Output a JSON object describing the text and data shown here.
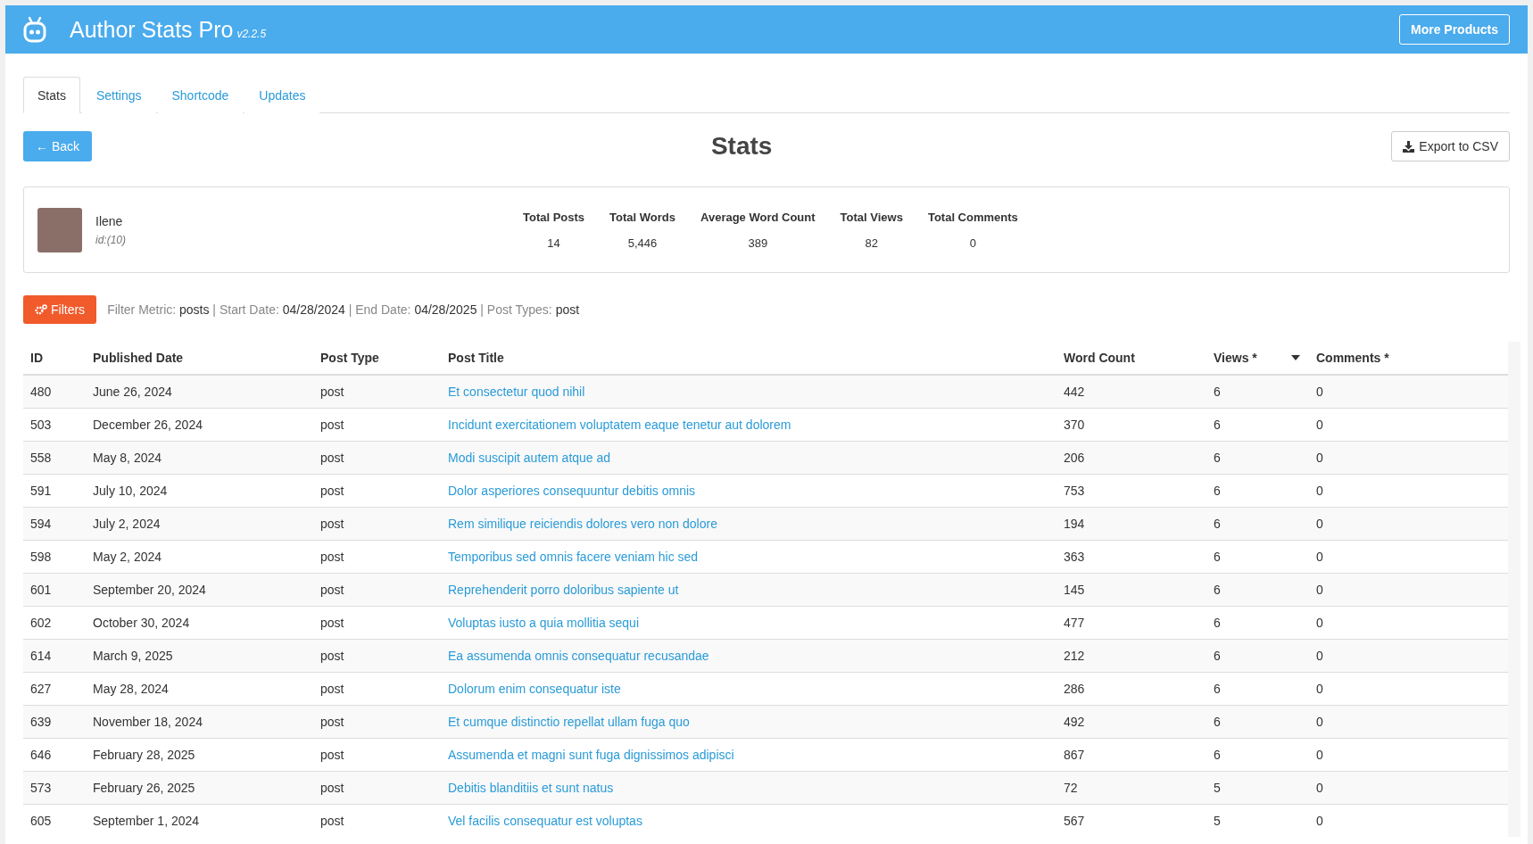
{
  "header": {
    "title": "Author Stats Pro",
    "version": "v2.2.5",
    "button": "More Products"
  },
  "tabs": [
    {
      "label": "Stats",
      "selected": true
    },
    {
      "label": "Settings",
      "selected": false
    },
    {
      "label": "Shortcode",
      "selected": false
    },
    {
      "label": "Updates",
      "selected": false
    }
  ],
  "toolbar": {
    "back": "← Back",
    "title": "Stats",
    "export": "Export to CSV"
  },
  "author": {
    "name": "Ilene",
    "id": "id:(10)"
  },
  "totals": [
    {
      "label": "Total Posts",
      "value": "14"
    },
    {
      "label": "Total Words",
      "value": "5,446"
    },
    {
      "label": "Average Word Count",
      "value": "389"
    },
    {
      "label": "Total Views",
      "value": "82"
    },
    {
      "label": "Total Comments",
      "value": "0"
    }
  ],
  "filters": {
    "button": "Filters",
    "summary": "Filter Metric: **posts** | Start Date: **04/28/2024** | End Date: **04/28/2025** | Post Types: **post**"
  },
  "table": {
    "columns": [
      {
        "label": "ID",
        "sorted": false
      },
      {
        "label": "Published Date",
        "sorted": false
      },
      {
        "label": "Post Type",
        "sorted": false
      },
      {
        "label": "Post Title",
        "sorted": false
      },
      {
        "label": "Word Count",
        "sorted": false
      },
      {
        "label": "Views *",
        "sorted": true
      },
      {
        "label": "Comments *",
        "sorted": false
      }
    ],
    "rows": [
      [
        "480",
        "June 26, 2024",
        "post",
        "Et consectetur quod nihil",
        "442",
        "6",
        "0"
      ],
      [
        "503",
        "December 26, 2024",
        "post",
        "Incidunt exercitationem voluptatem eaque tenetur aut dolorem",
        "370",
        "6",
        "0"
      ],
      [
        "558",
        "May 8, 2024",
        "post",
        "Modi suscipit autem atque ad",
        "206",
        "6",
        "0"
      ],
      [
        "591",
        "July 10, 2024",
        "post",
        "Dolor asperiores consequuntur debitis omnis",
        "753",
        "6",
        "0"
      ],
      [
        "594",
        "July 2, 2024",
        "post",
        "Rem similique reiciendis dolores vero non dolore",
        "194",
        "6",
        "0"
      ],
      [
        "598",
        "May 2, 2024",
        "post",
        "Temporibus sed omnis facere veniam hic sed",
        "363",
        "6",
        "0"
      ],
      [
        "601",
        "September 20, 2024",
        "post",
        "Reprehenderit porro doloribus sapiente ut",
        "145",
        "6",
        "0"
      ],
      [
        "602",
        "October 30, 2024",
        "post",
        "Voluptas iusto a quia mollitia sequi",
        "477",
        "6",
        "0"
      ],
      [
        "614",
        "March 9, 2025",
        "post",
        "Ea assumenda omnis consequatur recusandae",
        "212",
        "6",
        "0"
      ],
      [
        "627",
        "May 28, 2024",
        "post",
        "Dolorum enim consequatur iste",
        "286",
        "6",
        "0"
      ],
      [
        "639",
        "November 18, 2024",
        "post",
        "Et cumque distinctio repellat ullam fuga quo",
        "492",
        "6",
        "0"
      ],
      [
        "646",
        "February 28, 2025",
        "post",
        "Assumenda et magni sunt fuga dignissimos adipisci",
        "867",
        "6",
        "0"
      ],
      [
        "573",
        "February 26, 2025",
        "post",
        "Debitis blanditiis et sunt natus",
        "72",
        "5",
        "0"
      ],
      [
        "605",
        "September 1, 2024",
        "post",
        "Vel facilis consequatur est voluptas",
        "567",
        "5",
        "0"
      ]
    ]
  }
}
